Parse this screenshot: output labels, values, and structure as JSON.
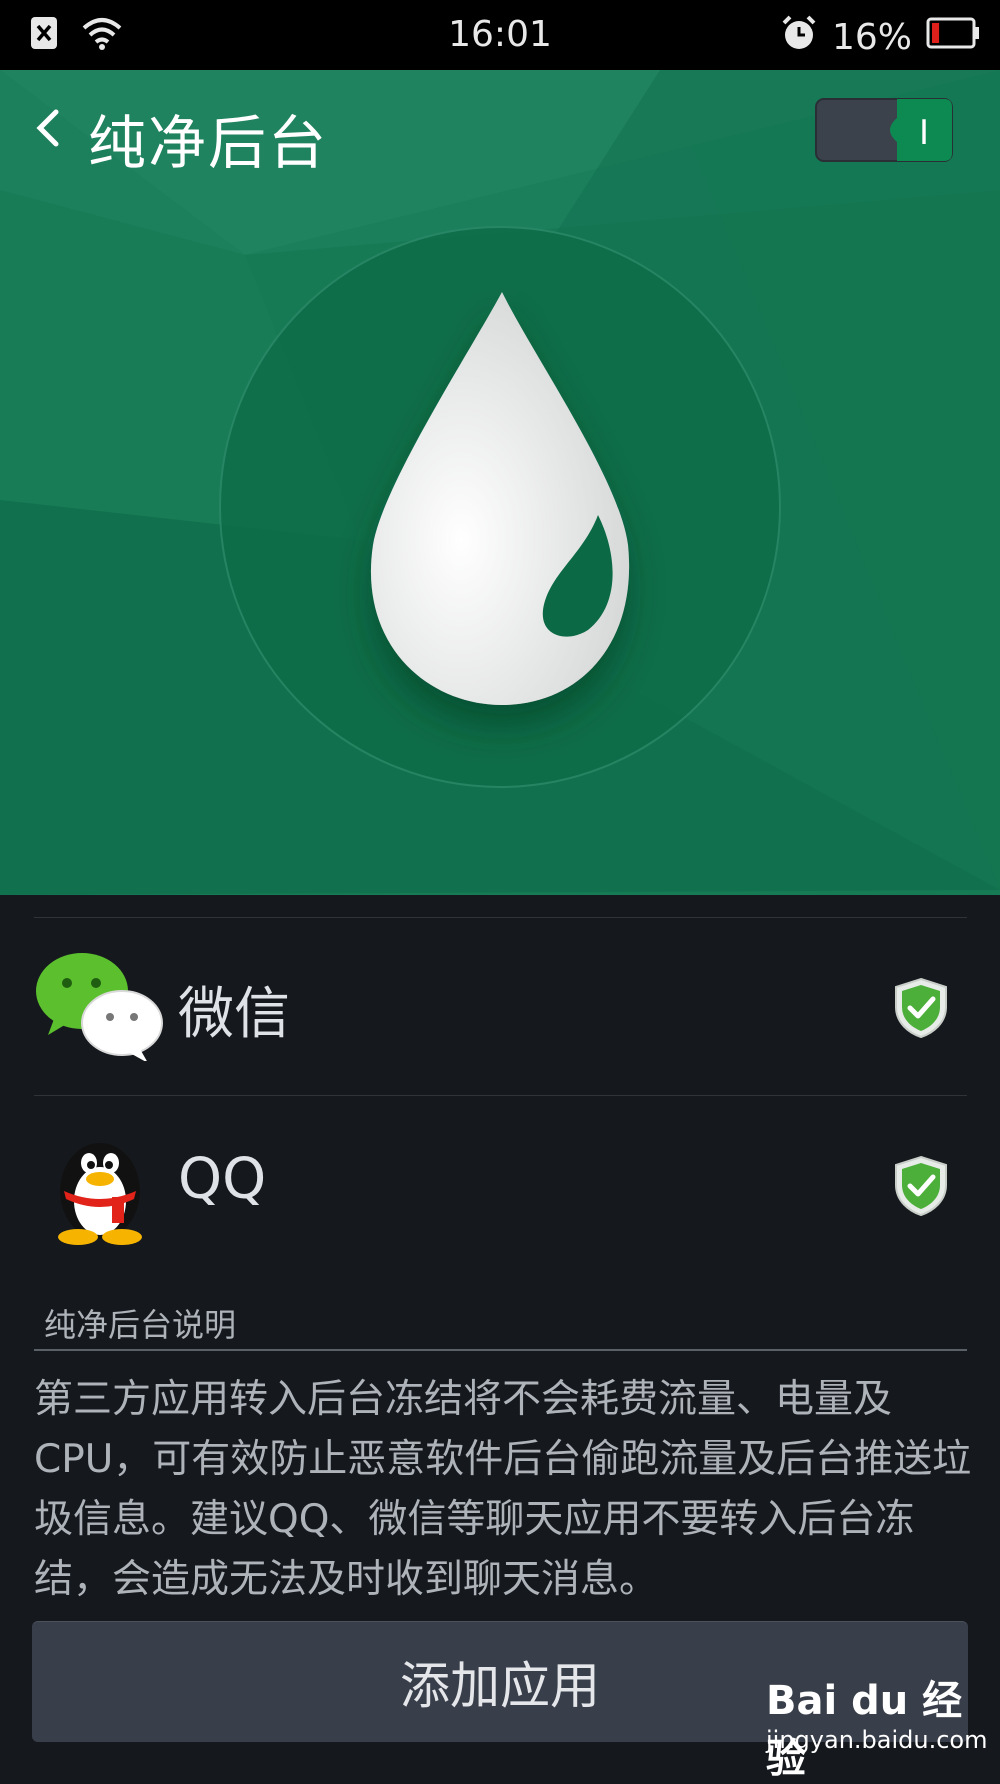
{
  "status_bar": {
    "time": "16:01",
    "battery_percent": "16%",
    "battery_level": 0.16,
    "icons": [
      "notification-close-icon",
      "wifi-icon",
      "alarm-icon",
      "battery-icon"
    ]
  },
  "header": {
    "title": "纯净后台",
    "toggle_on": true,
    "toggle_label": "I"
  },
  "apps": [
    {
      "name": "微信",
      "icon": "wechat-icon",
      "protected": true
    },
    {
      "name": "QQ",
      "icon": "qq-penguin-icon",
      "protected": true
    }
  ],
  "info": {
    "title": "纯净后台说明",
    "description": "第三方应用转入后台冻结将不会耗费流量、电量及CPU，可有效防止恶意软件后台偷跑流量及后台推送垃圾信息。建议QQ、微信等聊天应用不要转入后台冻结，会造成无法及时收到聊天消息。"
  },
  "add_button": {
    "label": "添加应用"
  },
  "watermark": {
    "logo": "Bai du 经验",
    "url": "jingyan.baidu.com"
  },
  "colors": {
    "hero": "#167a55",
    "background": "#15181d",
    "button": "#393f4a",
    "shield": "#4caf3a"
  }
}
